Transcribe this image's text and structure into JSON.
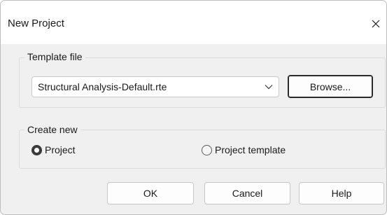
{
  "window": {
    "title": "New Project",
    "close_icon": "close-icon"
  },
  "template_file": {
    "group_label": "Template file",
    "selected_value": "Structural Analysis-Default.rte",
    "dropdown_icon": "chevron-down-icon",
    "browse_label": "Browse..."
  },
  "create_new": {
    "group_label": "Create new",
    "options": [
      {
        "label": "Project",
        "selected": true
      },
      {
        "label": "Project template",
        "selected": false
      }
    ]
  },
  "buttons": {
    "ok_label": "OK",
    "cancel_label": "Cancel",
    "help_label": "Help"
  }
}
